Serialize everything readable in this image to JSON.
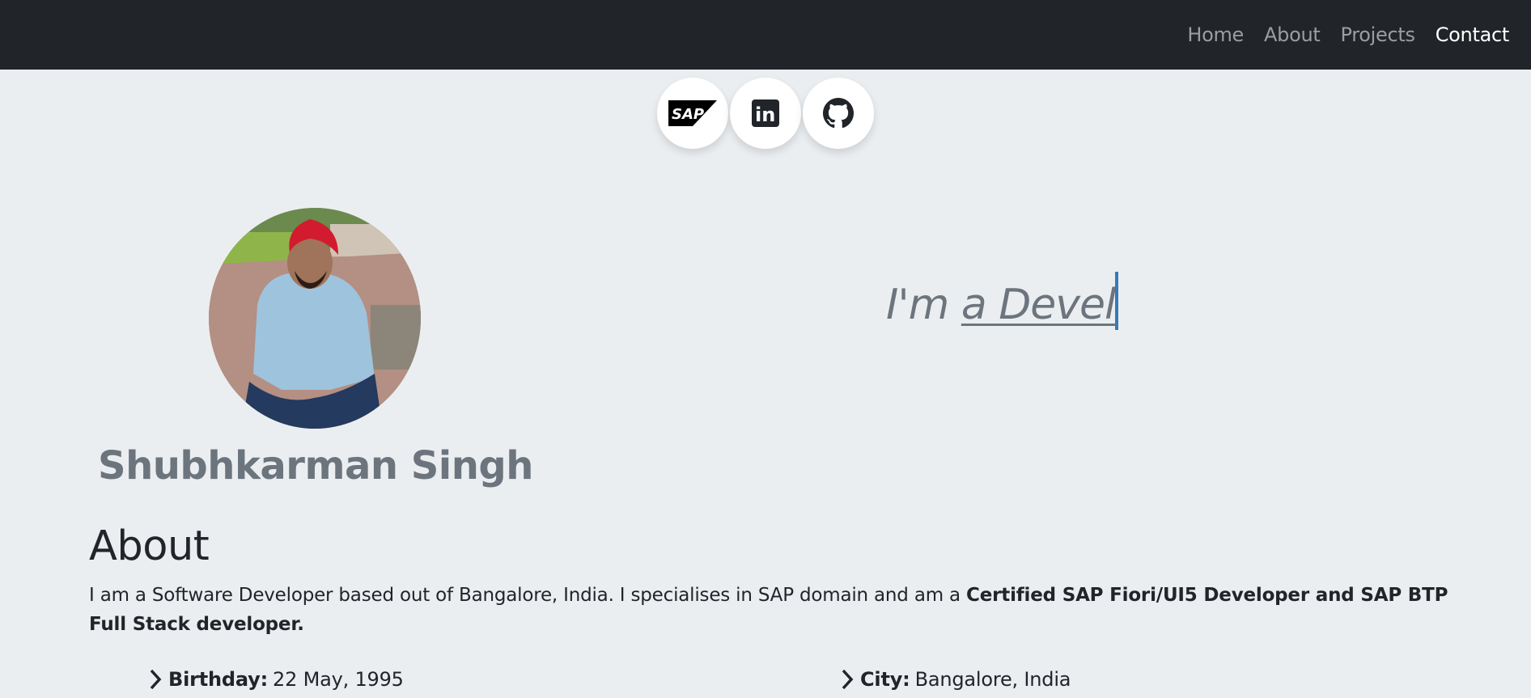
{
  "nav": {
    "links": [
      {
        "label": "Home"
      },
      {
        "label": "About"
      },
      {
        "label": "Projects"
      },
      {
        "label": "Contact"
      }
    ]
  },
  "social": [
    {
      "icon": "sap-icon",
      "text": "SAP"
    },
    {
      "icon": "linkedin-icon",
      "text": "in"
    },
    {
      "icon": "github-icon"
    }
  ],
  "profile": {
    "name": "Shubhkarman Singh",
    "typed_prefix": "I'm",
    "typed_word": "a Devel"
  },
  "about": {
    "title": "About",
    "text_plain": "I am a Software Developer based out of Bangalore, India. I specialises in SAP domain and am a ",
    "text_bold": "Certified SAP Fiori/UI5 Developer and SAP BTP Full Stack developer.",
    "details": [
      {
        "label": "Birthday:",
        "value": "22 May, 1995"
      },
      {
        "label": "City:",
        "value": "Bangalore, India"
      }
    ]
  },
  "colors": {
    "navbar": "#212529",
    "background": "#ebeef1",
    "muted": "#6c757d",
    "cursor": "#3a79b5"
  }
}
